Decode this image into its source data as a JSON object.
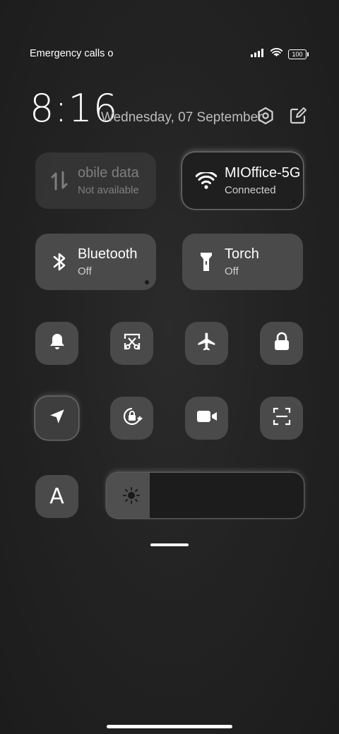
{
  "status_bar": {
    "carrier_text": "Emergency calls o",
    "battery": "100",
    "icons": [
      "signal-icon",
      "wifi-icon",
      "battery-icon"
    ]
  },
  "header": {
    "time": "8:16",
    "date": "Wednesday, 07 September",
    "icons": [
      "settings-icon",
      "edit-icon"
    ]
  },
  "tiles": {
    "mobile_data": {
      "title": "obile data",
      "subtitle": "Not available",
      "icon": "mobile-data-icon"
    },
    "wifi": {
      "title": "MIOffice-5G",
      "subtitle": "Connected",
      "icon": "wifi-icon"
    },
    "bluetooth": {
      "title": "Bluetooth",
      "subtitle": "Off",
      "icon": "bluetooth-icon"
    },
    "torch": {
      "title": "Torch",
      "subtitle": "Off",
      "icon": "torch-icon"
    }
  },
  "toggles": [
    {
      "name": "sound",
      "icon": "bell-icon"
    },
    {
      "name": "screenshot",
      "icon": "screenshot-icon"
    },
    {
      "name": "airplane-mode",
      "icon": "airplane-icon"
    },
    {
      "name": "lock-screen",
      "icon": "lock-icon"
    },
    {
      "name": "location",
      "icon": "location-icon",
      "active": true
    },
    {
      "name": "auto-rotate",
      "icon": "rotation-lock-icon"
    },
    {
      "name": "screen-recorder",
      "icon": "video-icon"
    },
    {
      "name": "scanner",
      "icon": "scan-icon"
    }
  ],
  "font_button": {
    "label": "A"
  },
  "brightness": {
    "level": 0.22,
    "icon": "brightness-icon"
  },
  "colors": {
    "tile": "#4a4a4a",
    "tile_active": "#1f1f1f",
    "text_secondary": "#cfcfcf"
  }
}
